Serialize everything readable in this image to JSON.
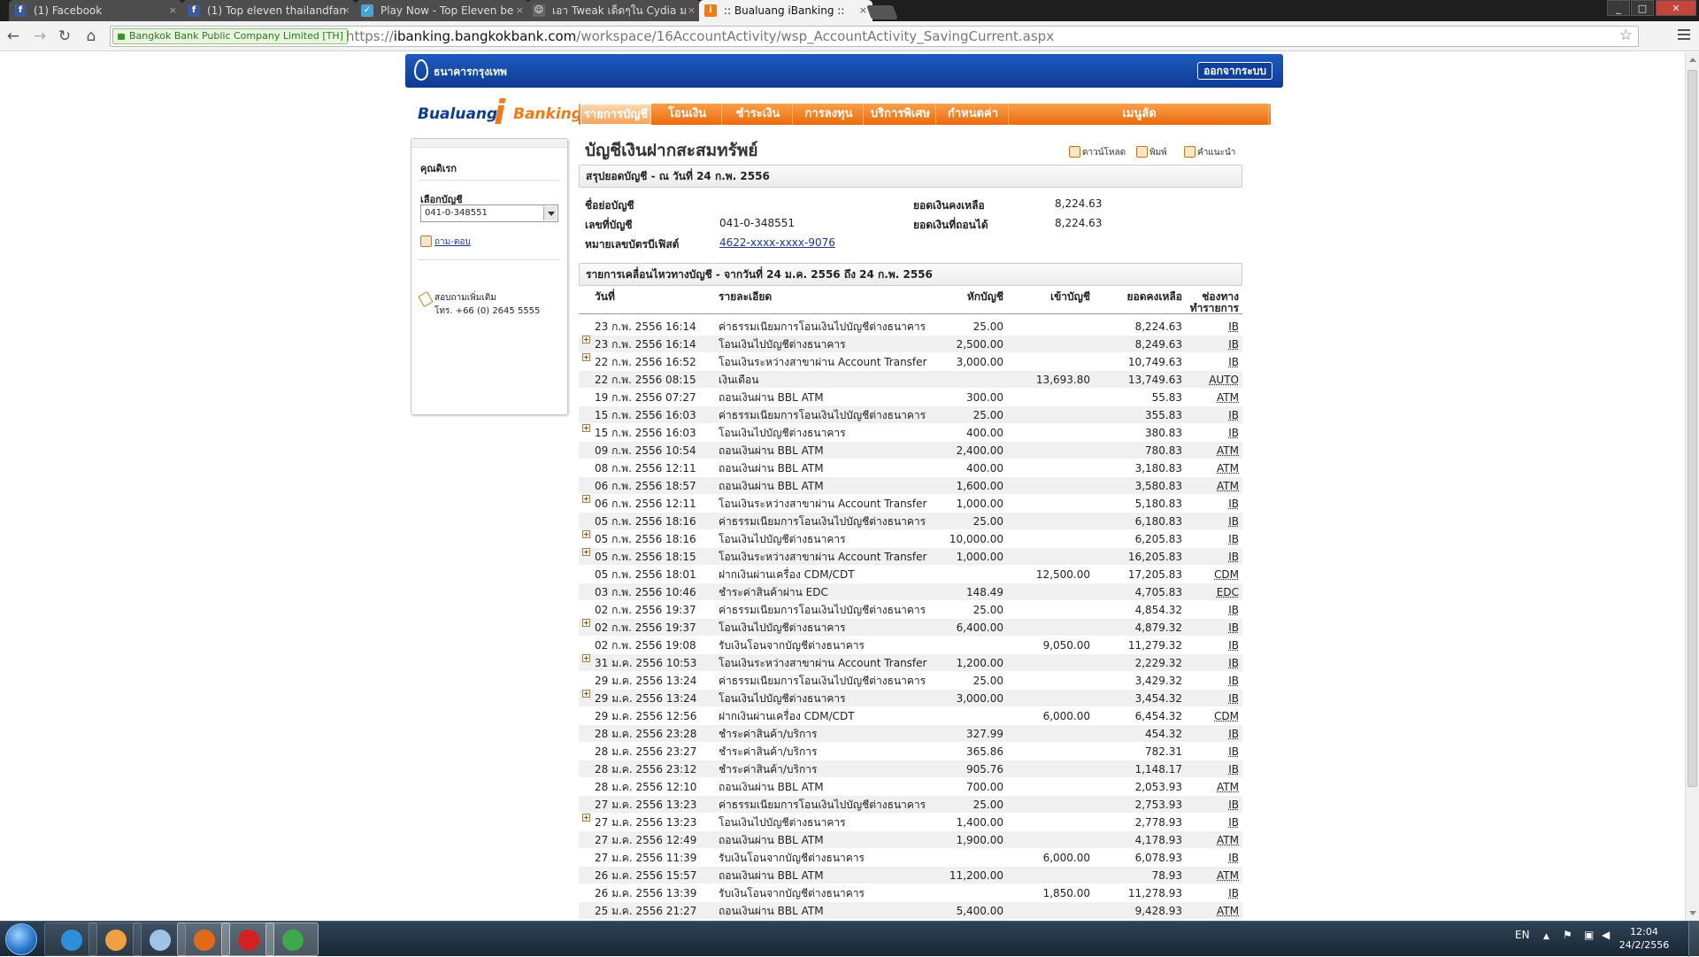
{
  "browser": {
    "tabs": [
      {
        "label": "(1) Facebook",
        "icon": "facebook-icon"
      },
      {
        "label": "(1) Top eleven thailandfan",
        "icon": "facebook-icon"
      },
      {
        "label": "Play Now - Top Eleven be",
        "icon": "game-icon"
      },
      {
        "label": "เอา Tweak เด็ดๆใน Cydia ม",
        "icon": "web-icon"
      },
      {
        "label": ":: Bualuang iBanking ::",
        "icon": "bualuang-icon"
      }
    ],
    "active_tab_index": 4,
    "close_glyph": "×",
    "security_label": "Bangkok Bank Public Company Limited [TH]",
    "url_scheme": "https://",
    "url_host": "ibanking.bangkokbank.com",
    "url_path": "/workspace/16AccountActivity/wsp_AccountActivity_SavingCurrent.aspx"
  },
  "header": {
    "bank_name": "ธนาคารกรุงเทพ",
    "logout": "ออกจากระบบ",
    "logo_left": "Bualuang",
    "logo_i": "i",
    "logo_right": "Banking"
  },
  "menu": [
    {
      "label": "รายการบัญชี",
      "active": true
    },
    {
      "label": "โอนเงิน",
      "active": false
    },
    {
      "label": "ชำระเงิน",
      "active": false
    },
    {
      "label": "การลงทุน",
      "active": false
    },
    {
      "label": "บริการพิเศษ",
      "active": false
    },
    {
      "label": "กำหนดค่า",
      "active": false
    },
    {
      "label": "เมนูลัด",
      "active": false
    }
  ],
  "sidebar": {
    "greeting": "คุณดิเรก",
    "account_label": "เลือกบัญชี",
    "account_value": "041-0-348551",
    "faq_link": "ถาม-ตอบ",
    "contact_line1": "สอบถามเพิ่มเติม",
    "contact_line2": "โทร. +66 (0) 2645 5555"
  },
  "page": {
    "title": "บัญชีเงินฝากสะสมทรัพย์",
    "tools": {
      "excel": "ดาวน์โหลด",
      "print": "พิมพ์",
      "help": "คำแนะนำ"
    },
    "summary_header": "สรุปยอดบัญชี - ณ วันที่ 24 ก.พ. 2556",
    "summary": {
      "account_name_label": "ชื่อย่อบัญชี",
      "account_name_value": "",
      "account_no_label": "เลขที่บัญชี",
      "account_no_value": "041-0-348551",
      "card_label": "หมายเลขบัตรบีเฟิสต์",
      "card_value": "4622-xxxx-xxxx-9076",
      "balance_label": "ยอดเงินคงเหลือ",
      "balance_value": "8,224.63",
      "available_label": "ยอดเงินที่ถอนได้",
      "available_value": "8,224.63"
    },
    "activity_header": "รายการเคลื่อนไหวทางบัญชี - จากวันที่ 24 ม.ค. 2556 ถึง 24 ก.พ. 2556",
    "columns": {
      "date": "วันที่",
      "desc": "รายละเอียด",
      "debit": "หักบัญชี",
      "credit": "เข้าบัญชี",
      "balance": "ยอดคงเหลือ",
      "channel_1": "ช่องทาง",
      "channel_2": "ทำรายการ"
    }
  },
  "transactions": [
    {
      "date": "23 ก.พ. 2556 16:14",
      "desc": "ค่าธรรมเนียมการโอนเงินไปบัญชีต่างธนาคาร",
      "debit": "25.00",
      "credit": "",
      "balance": "8,224.63",
      "channel": "IB",
      "expandable": false
    },
    {
      "date": "23 ก.พ. 2556 16:14",
      "desc": "โอนเงินไปบัญชีต่างธนาคาร",
      "debit": "2,500.00",
      "credit": "",
      "balance": "8,249.63",
      "channel": "IB",
      "expandable": true
    },
    {
      "date": "22 ก.พ. 2556 16:52",
      "desc": "โอนเงินระหว่างสาขาผ่าน Account Transfer",
      "debit": "3,000.00",
      "credit": "",
      "balance": "10,749.63",
      "channel": "IB",
      "expandable": true
    },
    {
      "date": "22 ก.พ. 2556 08:15",
      "desc": "เงินเดือน",
      "debit": "",
      "credit": "13,693.80",
      "balance": "13,749.63",
      "channel": "AUTO",
      "expandable": false
    },
    {
      "date": "19 ก.พ. 2556 07:27",
      "desc": "ถอนเงินผ่าน BBL ATM",
      "debit": "300.00",
      "credit": "",
      "balance": "55.83",
      "channel": "ATM",
      "expandable": false
    },
    {
      "date": "15 ก.พ. 2556 16:03",
      "desc": "ค่าธรรมเนียมการโอนเงินไปบัญชีต่างธนาคาร",
      "debit": "25.00",
      "credit": "",
      "balance": "355.83",
      "channel": "IB",
      "expandable": false
    },
    {
      "date": "15 ก.พ. 2556 16:03",
      "desc": "โอนเงินไปบัญชีต่างธนาคาร",
      "debit": "400.00",
      "credit": "",
      "balance": "380.83",
      "channel": "IB",
      "expandable": true
    },
    {
      "date": "09 ก.พ. 2556 10:54",
      "desc": "ถอนเงินผ่าน BBL ATM",
      "debit": "2,400.00",
      "credit": "",
      "balance": "780.83",
      "channel": "ATM",
      "expandable": false
    },
    {
      "date": "08 ก.พ. 2556 12:11",
      "desc": "ถอนเงินผ่าน BBL ATM",
      "debit": "400.00",
      "credit": "",
      "balance": "3,180.83",
      "channel": "ATM",
      "expandable": false
    },
    {
      "date": "06 ก.พ. 2556 18:57",
      "desc": "ถอนเงินผ่าน BBL ATM",
      "debit": "1,600.00",
      "credit": "",
      "balance": "3,580.83",
      "channel": "ATM",
      "expandable": false
    },
    {
      "date": "06 ก.พ. 2556 12:11",
      "desc": "โอนเงินระหว่างสาขาผ่าน Account Transfer",
      "debit": "1,000.00",
      "credit": "",
      "balance": "5,180.83",
      "channel": "IB",
      "expandable": true
    },
    {
      "date": "05 ก.พ. 2556 18:16",
      "desc": "ค่าธรรมเนียมการโอนเงินไปบัญชีต่างธนาคาร",
      "debit": "25.00",
      "credit": "",
      "balance": "6,180.83",
      "channel": "IB",
      "expandable": false
    },
    {
      "date": "05 ก.พ. 2556 18:16",
      "desc": "โอนเงินไปบัญชีต่างธนาคาร",
      "debit": "10,000.00",
      "credit": "",
      "balance": "6,205.83",
      "channel": "IB",
      "expandable": true
    },
    {
      "date": "05 ก.พ. 2556 18:15",
      "desc": "โอนเงินระหว่างสาขาผ่าน Account Transfer",
      "debit": "1,000.00",
      "credit": "",
      "balance": "16,205.83",
      "channel": "IB",
      "expandable": true
    },
    {
      "date": "05 ก.พ. 2556 18:01",
      "desc": "ฝากเงินผ่านเครื่อง CDM/CDT",
      "debit": "",
      "credit": "12,500.00",
      "balance": "17,205.83",
      "channel": "CDM",
      "expandable": false
    },
    {
      "date": "03 ก.พ. 2556 10:46",
      "desc": "ชำระค่าสินค้าผ่าน EDC",
      "debit": "148.49",
      "credit": "",
      "balance": "4,705.83",
      "channel": "EDC",
      "expandable": false
    },
    {
      "date": "02 ก.พ. 2556 19:37",
      "desc": "ค่าธรรมเนียมการโอนเงินไปบัญชีต่างธนาคาร",
      "debit": "25.00",
      "credit": "",
      "balance": "4,854.32",
      "channel": "IB",
      "expandable": false
    },
    {
      "date": "02 ก.พ. 2556 19:37",
      "desc": "โอนเงินไปบัญชีต่างธนาคาร",
      "debit": "6,400.00",
      "credit": "",
      "balance": "4,879.32",
      "channel": "IB",
      "expandable": true
    },
    {
      "date": "02 ก.พ. 2556 19:08",
      "desc": "รับเงินโอนจากบัญชีต่างธนาคาร",
      "debit": "",
      "credit": "9,050.00",
      "balance": "11,279.32",
      "channel": "IB",
      "expandable": false
    },
    {
      "date": "31 ม.ค. 2556 10:53",
      "desc": "โอนเงินระหว่างสาขาผ่าน Account Transfer",
      "debit": "1,200.00",
      "credit": "",
      "balance": "2,229.32",
      "channel": "IB",
      "expandable": true
    },
    {
      "date": "29 ม.ค. 2556 13:24",
      "desc": "ค่าธรรมเนียมการโอนเงินไปบัญชีต่างธนาคาร",
      "debit": "25.00",
      "credit": "",
      "balance": "3,429.32",
      "channel": "IB",
      "expandable": false
    },
    {
      "date": "29 ม.ค. 2556 13:24",
      "desc": "โอนเงินไปบัญชีต่างธนาคาร",
      "debit": "3,000.00",
      "credit": "",
      "balance": "3,454.32",
      "channel": "IB",
      "expandable": true
    },
    {
      "date": "29 ม.ค. 2556 12:56",
      "desc": "ฝากเงินผ่านเครื่อง CDM/CDT",
      "debit": "",
      "credit": "6,000.00",
      "balance": "6,454.32",
      "channel": "CDM",
      "expandable": false
    },
    {
      "date": "28 ม.ค. 2556 23:28",
      "desc": "ชำระค่าสินค้า/บริการ",
      "debit": "327.99",
      "credit": "",
      "balance": "454.32",
      "channel": "IB",
      "expandable": false
    },
    {
      "date": "28 ม.ค. 2556 23:27",
      "desc": "ชำระค่าสินค้า/บริการ",
      "debit": "365.86",
      "credit": "",
      "balance": "782.31",
      "channel": "IB",
      "expandable": false
    },
    {
      "date": "28 ม.ค. 2556 23:12",
      "desc": "ชำระค่าสินค้า/บริการ",
      "debit": "905.76",
      "credit": "",
      "balance": "1,148.17",
      "channel": "IB",
      "expandable": false
    },
    {
      "date": "28 ม.ค. 2556 12:10",
      "desc": "ถอนเงินผ่าน BBL ATM",
      "debit": "700.00",
      "credit": "",
      "balance": "2,053.93",
      "channel": "ATM",
      "expandable": false
    },
    {
      "date": "27 ม.ค. 2556 13:23",
      "desc": "ค่าธรรมเนียมการโอนเงินไปบัญชีต่างธนาคาร",
      "debit": "25.00",
      "credit": "",
      "balance": "2,753.93",
      "channel": "IB",
      "expandable": false
    },
    {
      "date": "27 ม.ค. 2556 13:23",
      "desc": "โอนเงินไปบัญชีต่างธนาคาร",
      "debit": "1,400.00",
      "credit": "",
      "balance": "2,778.93",
      "channel": "IB",
      "expandable": true
    },
    {
      "date": "27 ม.ค. 2556 12:49",
      "desc": "ถอนเงินผ่าน BBL ATM",
      "debit": "1,900.00",
      "credit": "",
      "balance": "4,178.93",
      "channel": "ATM",
      "expandable": false
    },
    {
      "date": "27 ม.ค. 2556 11:39",
      "desc": "รับเงินโอนจากบัญชีต่างธนาคาร",
      "debit": "",
      "credit": "6,000.00",
      "balance": "6,078.93",
      "channel": "IB",
      "expandable": false
    },
    {
      "date": "26 ม.ค. 2556 15:57",
      "desc": "ถอนเงินผ่าน BBL ATM",
      "debit": "11,200.00",
      "credit": "",
      "balance": "78.93",
      "channel": "ATM",
      "expandable": false
    },
    {
      "date": "26 ม.ค. 2556 13:39",
      "desc": "รับเงินโอนจากบัญชีต่างธนาคาร",
      "debit": "",
      "credit": "1,850.00",
      "balance": "11,278.93",
      "channel": "IB",
      "expandable": false
    },
    {
      "date": "25 ม.ค. 2556 21:27",
      "desc": "ถอนเงินผ่าน BBL ATM",
      "debit": "5,400.00",
      "credit": "",
      "balance": "9,428.93",
      "channel": "ATM",
      "expandable": false
    }
  ],
  "taskbar": {
    "apps": [
      "start-button",
      "internet-explorer-icon",
      "media-player-icon",
      "calculator-icon",
      "firefox-icon",
      "opera-icon",
      "chrome-icon"
    ],
    "lang": "EN",
    "time": "12:04",
    "date": "24/2/2556"
  }
}
